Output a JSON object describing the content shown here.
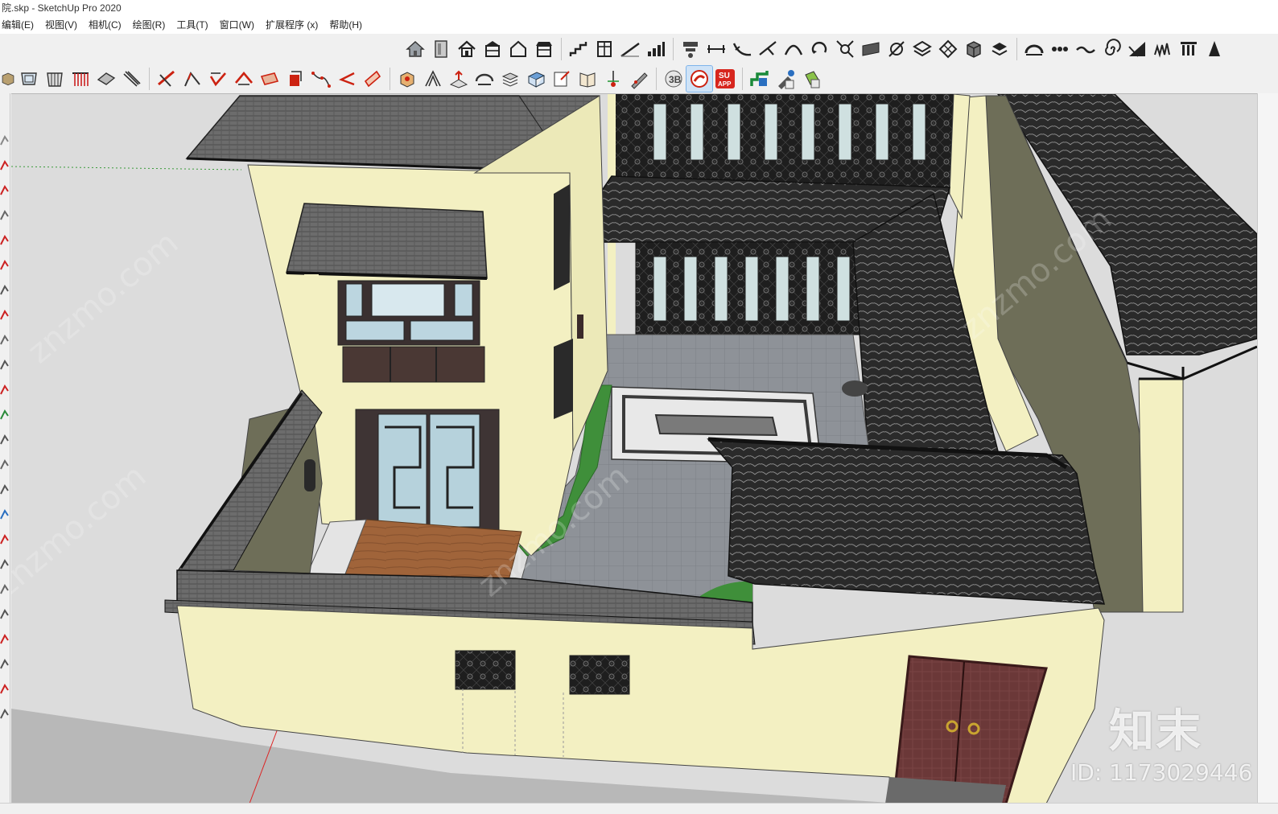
{
  "window": {
    "title": "院.skp - SketchUp Pro 2020"
  },
  "menu": {
    "items": [
      "编辑(E)",
      "视图(V)",
      "相机(C)",
      "绘图(R)",
      "工具(T)",
      "窗口(W)",
      "扩展程序 (x)",
      "帮助(H)"
    ]
  },
  "toolbar_top": {
    "icons": [
      "house-icon",
      "door-icon",
      "home-icon",
      "building-icon",
      "house-outline-icon",
      "store-icon",
      "stairs-icon",
      "window-icon",
      "ramp-icon",
      "bar-chart-icon",
      "align-icon",
      "dimension-icon",
      "fillet-icon",
      "extend-icon",
      "curve-icon",
      "rotate-icon",
      "join-icon",
      "panel-icon",
      "pen-icon",
      "layers-icon",
      "tiles-icon",
      "cube-icon",
      "stamp-icon",
      "arc-icon",
      "chain-icon",
      "wave-icon",
      "spiral-icon",
      "slope-icon",
      "graph-icon",
      "columns-icon",
      "mountain-icon"
    ]
  },
  "toolbar_second": {
    "icons": [
      "box-icon",
      "frame-icon",
      "grid-icon",
      "rail-icon",
      "slab-icon",
      "layers-stack-icon",
      "red-axes-icon",
      "bend-icon",
      "checkmark-icon",
      "roof-icon",
      "tray-icon",
      "push-icon",
      "path-icon",
      "arrow-left-icon",
      "flag-icon",
      "stamp-cube-icon",
      "scissors-icon",
      "mountain-push-icon",
      "arch-icon",
      "stack-icon",
      "box-blue-icon",
      "note-icon",
      "book-icon",
      "needle-icon",
      "pencil-icon",
      "3d-b-icon",
      "su-logo-icon",
      "su-app-icon",
      "stairs-green-icon",
      "eyedropper-icon",
      "paint-bucket-icon"
    ],
    "app_label": "SU\nAPP"
  },
  "viewport": {
    "watermark_logo": "知末",
    "watermark_id": "ID: 1173029446",
    "faint_watermark": "znzmo.com",
    "colors": {
      "wall": "#f3f0c2",
      "roof": "#2c2c2c",
      "roof_gray": "#6a6a6a",
      "ground": "#d8d8d8",
      "lawn": "#3f8f3a",
      "wood": "#a0643a",
      "door": "#6b3838",
      "paving": "#8e9298"
    }
  },
  "colors": {
    "accent": "#2e7fd6"
  }
}
